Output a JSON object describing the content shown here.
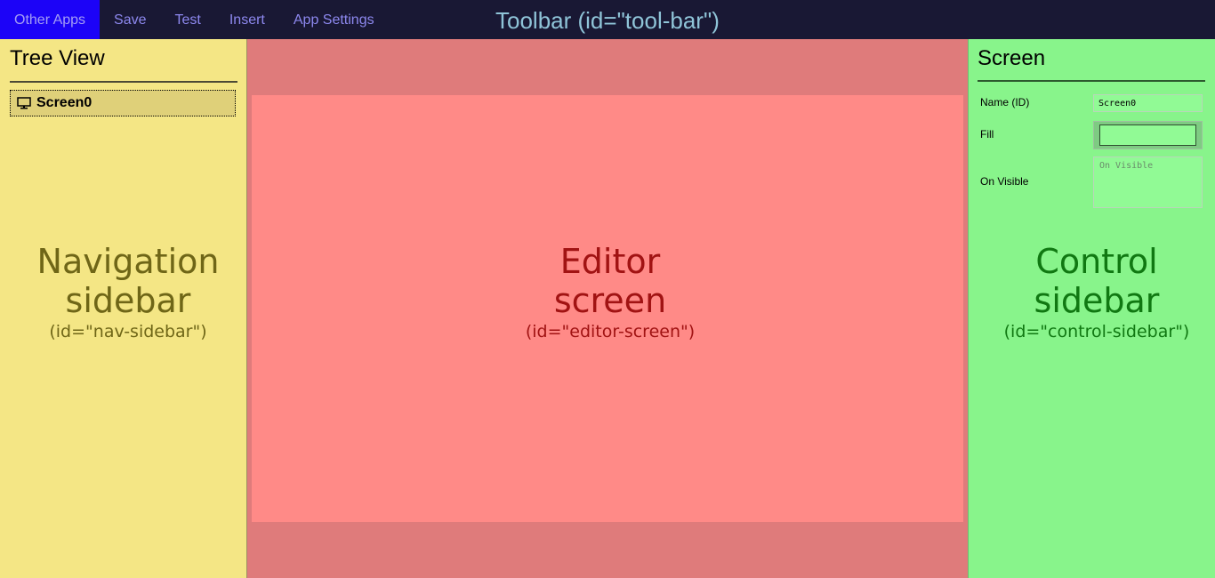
{
  "toolbar": {
    "menu": [
      {
        "label": "Other Apps",
        "active": true
      },
      {
        "label": "Save",
        "active": false
      },
      {
        "label": "Test",
        "active": false
      },
      {
        "label": "Insert",
        "active": false
      },
      {
        "label": "App Settings",
        "active": false
      }
    ],
    "caption": "Toolbar (id=\"tool-bar\")"
  },
  "nav_sidebar": {
    "title": "Tree View",
    "tree": [
      {
        "label": "Screen0",
        "icon": "monitor-icon"
      }
    ],
    "caption_line1": "Navigation",
    "caption_line2": "sidebar",
    "caption_id": "(id=\"nav-sidebar\")"
  },
  "editor": {
    "caption_line1": "Editor",
    "caption_line2": "screen",
    "caption_id": "(id=\"editor-screen\")"
  },
  "control_sidebar": {
    "title": "Screen",
    "props": {
      "name_label": "Name (ID)",
      "name_value": "Screen0",
      "fill_label": "Fill",
      "onvisible_label": "On Visible",
      "onvisible_placeholder": "On Visible"
    },
    "caption_line1": "Control",
    "caption_line2": "sidebar",
    "caption_id": "(id=\"control-sidebar\")"
  },
  "colors": {
    "toolbar_bg": "#191834",
    "menu_active_bg": "#1c03f7",
    "nav_bg": "#f4e685",
    "editor_area_bg": "#df7b7b",
    "editor_screen_bg": "#ff8a87",
    "control_bg": "#88f48b",
    "nav_caption": "#6f6617",
    "editor_caption": "#a11313",
    "control_caption": "#107812"
  }
}
